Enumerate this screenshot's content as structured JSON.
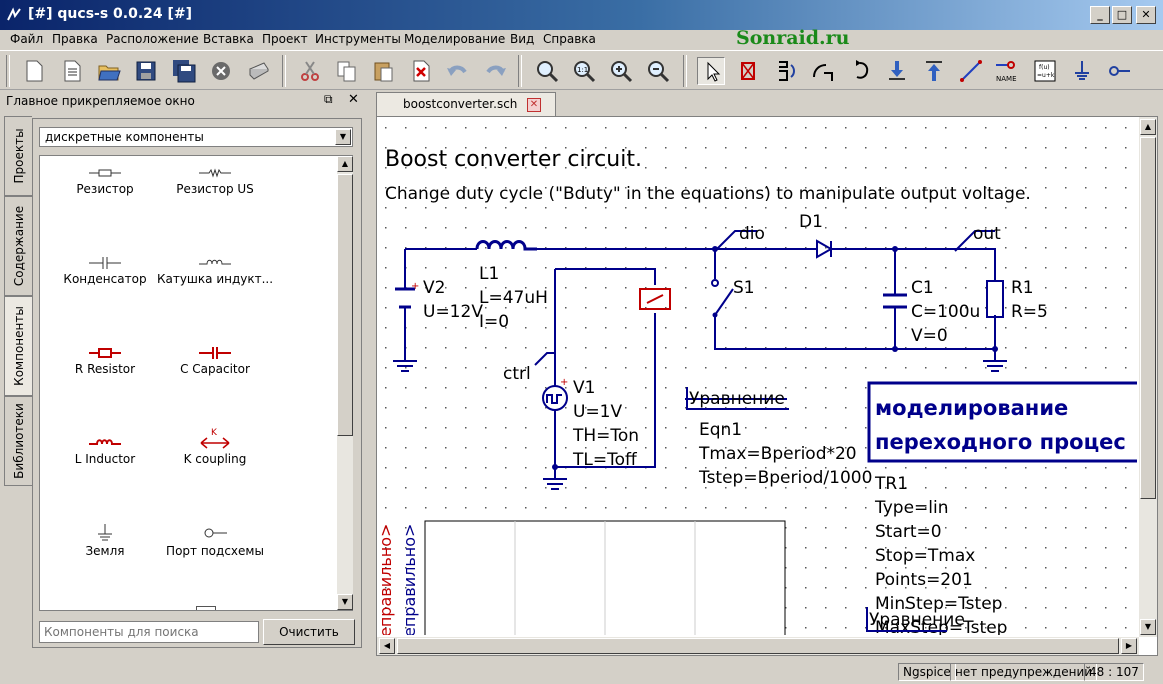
{
  "window": {
    "title": "[#] qucs-s 0.0.24 [#]",
    "minimize": "_",
    "maximize": "□",
    "close": "✕"
  },
  "watermark": "Sonraid.ru",
  "menu": [
    "Файл",
    "Правка",
    "Расположение",
    "Вставка",
    "Проект",
    "Инструменты",
    "Моделирование",
    "Вид",
    "Справка"
  ],
  "toolbar_icons": [
    "new-file-icon",
    "new-text-icon",
    "open-icon",
    "save-icon",
    "save-all-icon",
    "close-doc-icon",
    "print-icon",
    "cut-icon",
    "copy-icon",
    "paste-icon",
    "delete-icon",
    "undo-icon",
    "redo-icon",
    "zoom-fit-icon",
    "zoom-1to1-icon",
    "zoom-in-icon",
    "zoom-out-icon",
    "select-icon",
    "deactivate-icon",
    "mirror-x-icon",
    "mirror-y-icon",
    "rotate-icon",
    "enter-subcircuit-icon",
    "exit-subcircuit-icon",
    "wire-icon",
    "wire-label-icon",
    "equation-icon",
    "ground-icon",
    "port-icon"
  ],
  "toolbar_text": {
    "name": "NAME",
    "eq": "f(u)\n=u+k"
  },
  "dock": {
    "title": "Главное прикрепляемое окно",
    "float": "⧉",
    "close": "✕",
    "vtabs": [
      "Проекты",
      "Содержание",
      "Компоненты",
      "Библиотеки"
    ],
    "category": "дискретные компоненты",
    "components": [
      {
        "label": "Резистор",
        "icon": "resistor-icon"
      },
      {
        "label": "Резистор US",
        "icon": "resistor-us-icon"
      },
      {
        "label": "Конденсатор",
        "icon": "capacitor-icon"
      },
      {
        "label": "Катушка индукт...",
        "icon": "inductor-icon"
      },
      {
        "label": "R Resistor",
        "icon": "r-resistor-icon"
      },
      {
        "label": "C Capacitor",
        "icon": "c-capacitor-icon"
      },
      {
        "label": "L Inductor",
        "icon": "l-inductor-icon"
      },
      {
        "label": "K coupling",
        "icon": "k-coupling-icon"
      },
      {
        "label": "Земля",
        "icon": "ground-icon"
      },
      {
        "label": "Порт подсхемы",
        "icon": "subcircuit-port-icon"
      }
    ],
    "search_placeholder": "Компоненты для поиска",
    "clear_label": "Очистить"
  },
  "editor": {
    "tab_label": "boostconverter.sch",
    "title": "Boost converter circuit.",
    "subtitle": "Change duty cycle (\"Bduty\" in the equations) to manipulate output voltage.",
    "labels": {
      "dio": "dio",
      "d1": "D1",
      "out": "out",
      "l1": "L1",
      "l1_l": "L=47uH",
      "l1_i": "I=0",
      "v2": "V2",
      "v2_u": "U=12V",
      "s1": "S1",
      "c1": "C1",
      "c1_c": "C=100u",
      "c1_v": "V=0",
      "r1": "R1",
      "r1_r": "R=5",
      "ctrl": "ctrl",
      "v1": "V1",
      "v1_u": "U=1V",
      "v1_th": "TH=Ton",
      "v1_tl": "TL=Toff",
      "eq_title": "Уравнение",
      "eq_name": "Eqn1",
      "eq_tmax": "Tmax=Bperiod*20",
      "eq_tstep": "Tstep=Bperiod/1000",
      "sim_line1": "моделирование",
      "sim_line2": "переходного процес",
      "tr1": "TR1",
      "tr_type": "Type=lin",
      "tr_start": "Start=0",
      "tr_stop": "Stop=Tmax",
      "tr_points": "Points=201",
      "tr_minstep": "MinStep=Tstep",
      "tr_maxstep": "MaxStep=Tstep",
      "eq2_title": "Уравнение",
      "diag_red": "еправильно>",
      "diag_blue": "еправильно>"
    }
  },
  "status": {
    "simulator": "Ngspice",
    "warnings": "нет предупреждений",
    "position": "48 : 107"
  },
  "colors": {
    "wire": "#00008b",
    "component": "#00008b",
    "red": "#c00000"
  }
}
